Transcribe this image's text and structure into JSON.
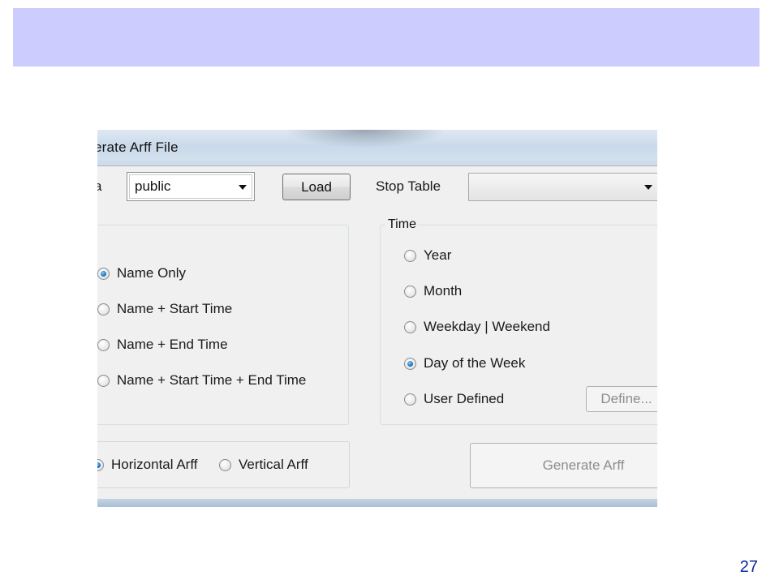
{
  "slide": {
    "number": "27"
  },
  "window": {
    "title": "erate Arff File",
    "schema_label": "a",
    "schema_value": "public",
    "load_label": "Load",
    "stop_table_label": "Stop Table",
    "stop_table_value": ""
  },
  "name_group": {
    "options": [
      {
        "label": "Name Only",
        "selected": true
      },
      {
        "label": "Name + Start Time",
        "selected": false
      },
      {
        "label": "Name + End Time",
        "selected": false
      },
      {
        "label": "Name + Start Time + End Time",
        "selected": false
      }
    ]
  },
  "time_group": {
    "title": "Time",
    "options": [
      {
        "label": "Year",
        "selected": false
      },
      {
        "label": "Month",
        "selected": false
      },
      {
        "label": "Weekday | Weekend",
        "selected": false
      },
      {
        "label": "Day of the Week",
        "selected": true
      },
      {
        "label": "User Defined",
        "selected": false
      }
    ],
    "define_label": "Define..."
  },
  "format_group": {
    "options": [
      {
        "label": "Horizontal Arff",
        "selected": true
      },
      {
        "label": "Vertical Arff",
        "selected": false
      }
    ]
  },
  "generate_label": "Generate Arff",
  "colors": {
    "banner": "#ccccff",
    "slide_number": "#0a2a9a",
    "radio_selected": "#1d72c4"
  }
}
